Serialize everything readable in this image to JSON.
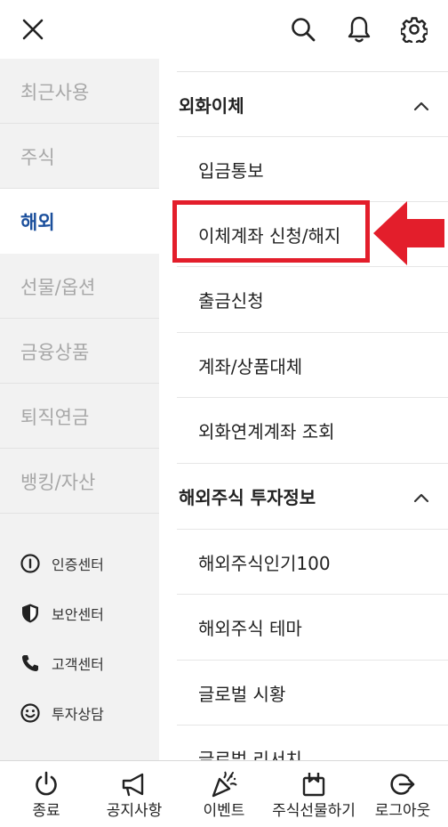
{
  "header": {
    "close_icon": "close-icon",
    "search_icon": "search-icon",
    "bell_icon": "bell-icon",
    "gear_icon": "gear-icon"
  },
  "sidebar": {
    "categories": [
      {
        "label": "최근사용"
      },
      {
        "label": "주식"
      },
      {
        "label": "해외",
        "active": true
      },
      {
        "label": "선물/옵션"
      },
      {
        "label": "금융상품"
      },
      {
        "label": "퇴직연금"
      },
      {
        "label": "뱅킹/자산"
      }
    ],
    "utilities": [
      {
        "label": "인증센터",
        "icon": "certificate-icon"
      },
      {
        "label": "보안센터",
        "icon": "shield-icon"
      },
      {
        "label": "고객센터",
        "icon": "phone-icon"
      },
      {
        "label": "투자상담",
        "icon": "smile-icon"
      }
    ]
  },
  "menu": {
    "sections": [
      {
        "title": "외화이체",
        "expanded": true,
        "items": [
          "입금통보",
          "이체계좌 신청/해지",
          "출금신청",
          "계좌/상품대체",
          "외화연계계좌 조회"
        ]
      },
      {
        "title": "해외주식 투자정보",
        "expanded": true,
        "items": [
          "해외주식인기100",
          "해외주식 테마",
          "글로벌 시황",
          "글로벌 리서치"
        ]
      }
    ],
    "highlighted_item": "이체계좌 신청/해지",
    "highlight_color": "#e31e2b"
  },
  "bottom_bar": [
    {
      "label": "종료",
      "icon": "power-icon"
    },
    {
      "label": "공지사항",
      "icon": "megaphone-icon"
    },
    {
      "label": "이벤트",
      "icon": "party-popper-icon"
    },
    {
      "label": "주식선물하기",
      "icon": "gift-box-icon"
    },
    {
      "label": "로그아웃",
      "icon": "logout-icon"
    }
  ],
  "colors": {
    "accent": "#1b4f9c",
    "sidebar_bg": "#f2f2f2",
    "inactive_text": "#a7a7a7",
    "highlight": "#e31e2b"
  }
}
